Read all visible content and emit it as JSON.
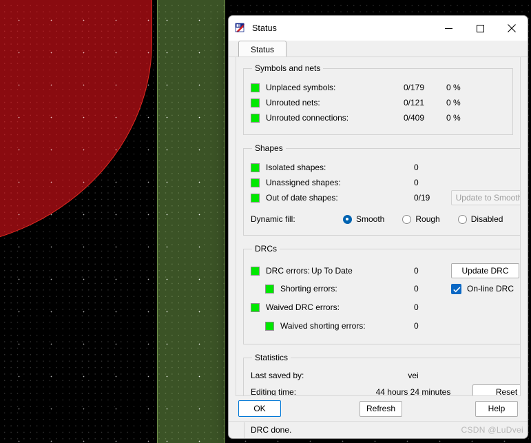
{
  "background": {
    "name": "pcb-editor-canvas",
    "colors": {
      "board": "#000000",
      "red_plane": "#8a0b10",
      "red_outline": "#e02b22",
      "green_strip": "#3b5326",
      "green_outline": "#6f8f4a"
    }
  },
  "window": {
    "title": "Status",
    "icon": "altium-status-icon",
    "minimize_label": "Minimize",
    "maximize_label": "Maximize",
    "close_label": "Close"
  },
  "tabs": [
    {
      "label": "Status",
      "active": true
    }
  ],
  "groups": {
    "symbols_and_nets": {
      "legend": "Symbols and nets",
      "rows": [
        {
          "label": "Unplaced symbols:",
          "count": "0/179",
          "percent": "0 %",
          "led": "green"
        },
        {
          "label": "Unrouted nets:",
          "count": "0/121",
          "percent": "0 %",
          "led": "green"
        },
        {
          "label": "Unrouted connections:",
          "count": "0/409",
          "percent": "0 %",
          "led": "green"
        }
      ]
    },
    "shapes": {
      "legend": "Shapes",
      "rows": [
        {
          "label": "Isolated shapes:",
          "count": "0",
          "led": "green"
        },
        {
          "label": "Unassigned shapes:",
          "count": "0",
          "led": "green"
        },
        {
          "label": "Out of date shapes:",
          "count": "0/19",
          "led": "green"
        }
      ],
      "update_to_smooth_label": "Update to Smooth",
      "update_to_smooth_enabled": false,
      "dynamic_fill_label": "Dynamic fill:",
      "dynamic_fill_options": [
        "Smooth",
        "Rough",
        "Disabled"
      ],
      "dynamic_fill_selected": "Smooth"
    },
    "drcs": {
      "legend": "DRCs",
      "drc_errors_label": "DRC errors:",
      "drc_errors_state": "Up To Date",
      "drc_errors_count": "0",
      "shorting_errors_label": "Shorting errors:",
      "shorting_errors_count": "0",
      "waived_drc_errors_label": "Waived DRC errors:",
      "waived_drc_errors_count": "0",
      "waived_shorting_errors_label": "Waived shorting errors:",
      "waived_shorting_errors_count": "0",
      "update_drc_label": "Update DRC",
      "online_drc_label": "On-line DRC",
      "online_drc_checked": true
    },
    "statistics": {
      "legend": "Statistics",
      "last_saved_by_label": "Last saved by:",
      "last_saved_by_value": "vei",
      "editing_time_label": "Editing time:",
      "editing_time_value": "44 hours 24 minutes",
      "reset_label": "Reset"
    }
  },
  "footer": {
    "ok_label": "OK",
    "refresh_label": "Refresh",
    "help_label": "Help"
  },
  "statusbar": {
    "message": "DRC done.",
    "watermark": "CSDN @LuDvei"
  }
}
